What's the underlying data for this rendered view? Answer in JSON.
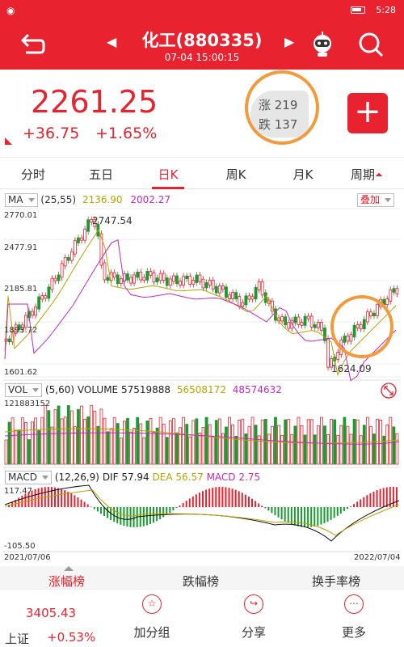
{
  "status_bar": {
    "time": "5:28"
  },
  "header": {
    "title": "化工(880335)",
    "subtitle": "07-04 15:00:15"
  },
  "quote": {
    "price": "2261.25",
    "change": "+36.75",
    "change_pct": "+1.65%",
    "up_label": "涨 219",
    "down_label": "跌 137"
  },
  "tabs": [
    {
      "label": "分时"
    },
    {
      "label": "五日"
    },
    {
      "label": "日K"
    },
    {
      "label": "周K"
    },
    {
      "label": "月K"
    },
    {
      "label": "周期"
    }
  ],
  "ma_legend": {
    "name": "MA",
    "params": "(25,55)",
    "ma25": "2136.90",
    "ma55": "2002.27",
    "overlay_button": "叠加"
  },
  "price_axis": [
    "2770.01",
    "2477.91",
    "2185.81",
    "1893.72",
    "1601.62"
  ],
  "annotations": {
    "high": "2747.54",
    "low": "1624.09"
  },
  "vol_legend": {
    "name": "VOL",
    "params": "(5,60)",
    "label": "VOLUME",
    "volume": "57519888",
    "ma5": "56508172",
    "ma60": "48574632"
  },
  "vol_axis_max": "121883152",
  "macd_legend": {
    "name": "MACD",
    "params": "(12,26,9)",
    "dif_label": "DIF",
    "dif": "57.94",
    "dea_label": "DEA",
    "dea": "56.57",
    "macd_label": "MACD",
    "macd": "2.75"
  },
  "macd_axis": {
    "max": "117.47",
    "min": "-105.50"
  },
  "date_axis": {
    "start": "2021/07/06",
    "end": "2022/07/04"
  },
  "bottom_tabs": [
    "涨幅榜",
    "跌幅榜",
    "换手率榜"
  ],
  "footer": {
    "index_value": "3405.43",
    "index_name": "上证",
    "index_pct": "+0.53%",
    "actions": [
      "加分组",
      "分享",
      "更多"
    ]
  },
  "colors": {
    "red": "#e8222f",
    "green": "#1a9a30",
    "accent": "#f39a3a"
  }
}
